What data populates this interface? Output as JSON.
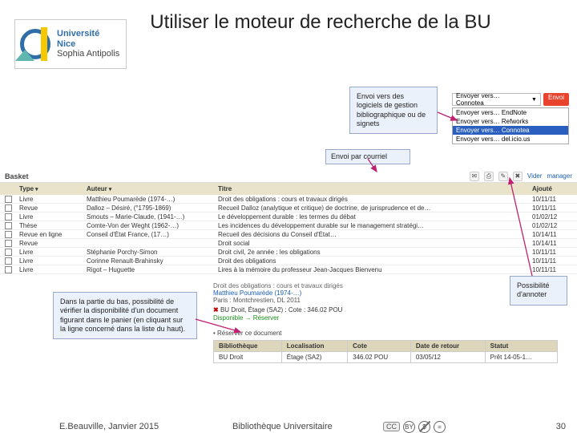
{
  "logo": {
    "line1": "Université",
    "line2": "Nice",
    "line3": "Sophia Antipolis"
  },
  "title": "Utiliser le moteur de recherche de la BU",
  "callouts": {
    "envoi_log": "Envoi vers des logiciels de gestion bibliographique ou de signets",
    "courriel": "Envoi par courriel",
    "annoter": "Possibilité d'annoter",
    "bas": "Dans la partie du bas, possibilité de vérifier la disponibilité d'un document figurant dans le panier (en cliquant sur la ligne concerné dans la liste du haut)."
  },
  "envoyer": {
    "chip": "Envoyer vers… Connotea",
    "button": "Envoi",
    "items": [
      {
        "label": "Envoyer vers… EndNote",
        "selected": false
      },
      {
        "label": "Envoyer vers… Refworks",
        "selected": false
      },
      {
        "label": "Envoyer vers… Connotea",
        "selected": true
      },
      {
        "label": "Envoyer vers… del.icio.us",
        "selected": false
      }
    ]
  },
  "basket": {
    "label": "Basket",
    "columns": {
      "type": "Type",
      "auteur": "Auteur",
      "titre": "Titre",
      "ajoute": "Ajouté"
    },
    "clear": "Vider",
    "manage": "manager",
    "rows": [
      {
        "type": "Livre",
        "auteur": "Matthieu Poumarède (1974-…)",
        "titre": "Droit des obligations : cours et travaux dirigés",
        "ajoute": "10/11/11"
      },
      {
        "type": "Revue",
        "auteur": "Dalloz – Désiré, (°1795-1869)",
        "titre": "Recueil Dalloz (analytique et critique) de doctrine, de jurisprudence et de…",
        "ajoute": "10/11/11"
      },
      {
        "type": "Livre",
        "auteur": "Smouts – Marie-Claude, (1941-…)",
        "titre": "Le développement durable : les termes du débat",
        "ajoute": "01/02/12"
      },
      {
        "type": "Thèse",
        "auteur": "Comte-Von der Weght (1962-…)",
        "titre": "Les incidences du développement durable sur le management stratégi…",
        "ajoute": "01/02/12"
      },
      {
        "type": "Revue en ligne",
        "auteur": "Conseil d'État France, (17…)",
        "titre": "Recueil des décisions du Conseil d'État…",
        "ajoute": "10/14/11"
      },
      {
        "type": "Revue",
        "auteur": "",
        "titre": "Droit social",
        "ajoute": "10/14/11"
      },
      {
        "type": "Livre",
        "auteur": "Stéphanie Porchy-Simon",
        "titre": "Droit civil, 2e année : les obligations",
        "ajoute": "10/11/11"
      },
      {
        "type": "Livre",
        "auteur": "Corinne Renault-Brahinsky",
        "titre": "Droit des obligations",
        "ajoute": "10/11/11"
      },
      {
        "type": "Livre",
        "auteur": "Rigot – Huguette",
        "titre": "Lires à la mémoire du professeur Jean-Jacques Bienvenu",
        "ajoute": "10/11/11"
      }
    ]
  },
  "detail": {
    "title_line": "Droit des obligations : cours et travaux dirigés",
    "who": "Matthieu Poumarède (1974-…)",
    "place": "Paris : Montchrestien, DL 2011",
    "loc_mark": "✖",
    "loc_text": "BU Droit, Étage (SA2) : Cote : 346.02 POU",
    "avail": "Disponible → Réserver",
    "reserve": "• Réserver ce document",
    "cols": {
      "bib": "Bibliothèque",
      "loc": "Localisation",
      "cote": "Cote",
      "date": "Date de retour",
      "statut": "Statut"
    },
    "row": {
      "bib": "BU Droit",
      "loc": "Étage (SA2)",
      "cote": "346.02 POU",
      "date": "03/05/12",
      "statut": "Prêt 14-05-1…"
    }
  },
  "footer": {
    "left": "E.Beauville, Janvier 2015",
    "mid": "Bibliothèque Universitaire",
    "cc_label": "CC",
    "cc_by": "BY",
    "cc_nc": "$",
    "cc_nd": "=",
    "page": "30"
  }
}
